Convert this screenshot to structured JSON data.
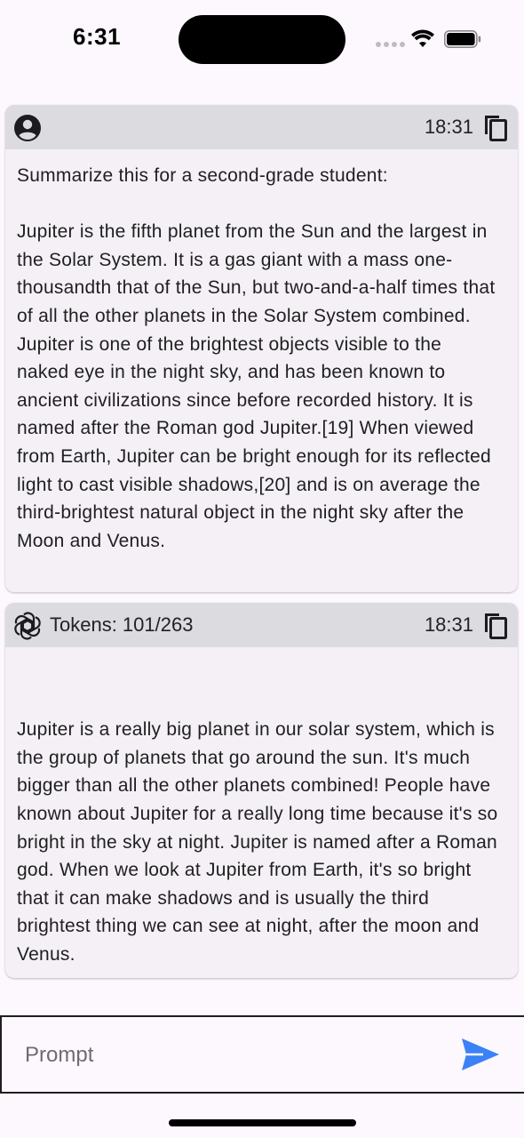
{
  "status_bar": {
    "time": "6:31"
  },
  "messages": [
    {
      "role": "user",
      "avatar_icon": "person-circle-icon",
      "time": "18:31",
      "text": "Summarize this for a second-grade student:\n\nJupiter is the fifth planet from the Sun and the largest in the Solar System. It is a gas giant with a mass one-thousandth that of the Sun, but two-and-a-half times that of all the other planets in the Solar System combined. Jupiter is one of the brightest objects visible to the naked eye in the night sky, and has been known to ancient civilizations since before recorded history. It is named after the Roman god Jupiter.[19] When viewed from Earth, Jupiter can be bright enough for its reflected light to cast visible shadows,[20] and is on average the third-brightest natural object in the night sky after the Moon and Venus."
    },
    {
      "role": "assistant",
      "avatar_icon": "openai-logo-icon",
      "tokens": "Tokens: 101/263",
      "time": "18:31",
      "text": "\n\nJupiter is a really big planet in our solar system, which is the group of planets that go around the sun. It's much bigger than all the other planets combined! People have known about Jupiter for a really long time because it's so bright in the sky at night. Jupiter is named after a Roman god. When we look at Jupiter from Earth, it's so bright that it can make shadows and is usually the third brightest thing we can see at night, after the moon and Venus."
    }
  ],
  "prompt": {
    "placeholder": "Prompt",
    "value": ""
  },
  "colors": {
    "send_accent": "#3b82f6",
    "header_bg": "#dcdbe0",
    "card_bg": "#f4f0f6"
  }
}
